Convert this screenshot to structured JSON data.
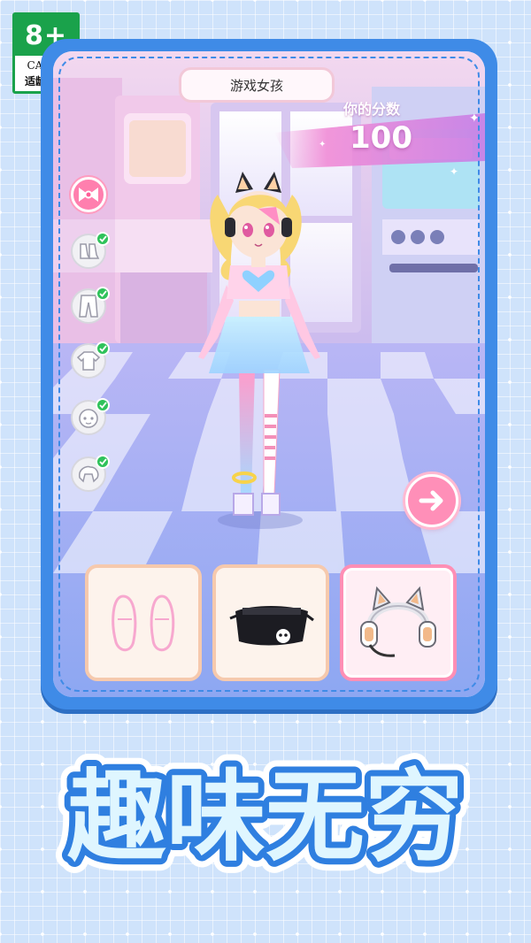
{
  "age_badge": {
    "rating": "8+",
    "org": "CADPA",
    "note": "适龄提示"
  },
  "game": {
    "title": "游戏女孩",
    "score_label": "你的分数",
    "score_value": "100"
  },
  "categories": [
    {
      "icon": "bow-icon",
      "state": "active"
    },
    {
      "icon": "shoes-icon",
      "state": "done"
    },
    {
      "icon": "pants-icon",
      "state": "done"
    },
    {
      "icon": "top-icon",
      "state": "done"
    },
    {
      "icon": "face-icon",
      "state": "done"
    },
    {
      "icon": "hair-icon",
      "state": "done"
    }
  ],
  "items": [
    {
      "icon": "slippers-outline-icon",
      "selected": false
    },
    {
      "icon": "black-skirt-icon",
      "selected": false
    },
    {
      "icon": "cat-ear-headphones-icon",
      "selected": true
    }
  ],
  "headline": "趣味无穷",
  "colors": {
    "frame_blue": "#3f8be7",
    "accent_pink": "#ff8fb8",
    "check_green": "#2fc25b",
    "badge_green": "#1aa24b"
  }
}
